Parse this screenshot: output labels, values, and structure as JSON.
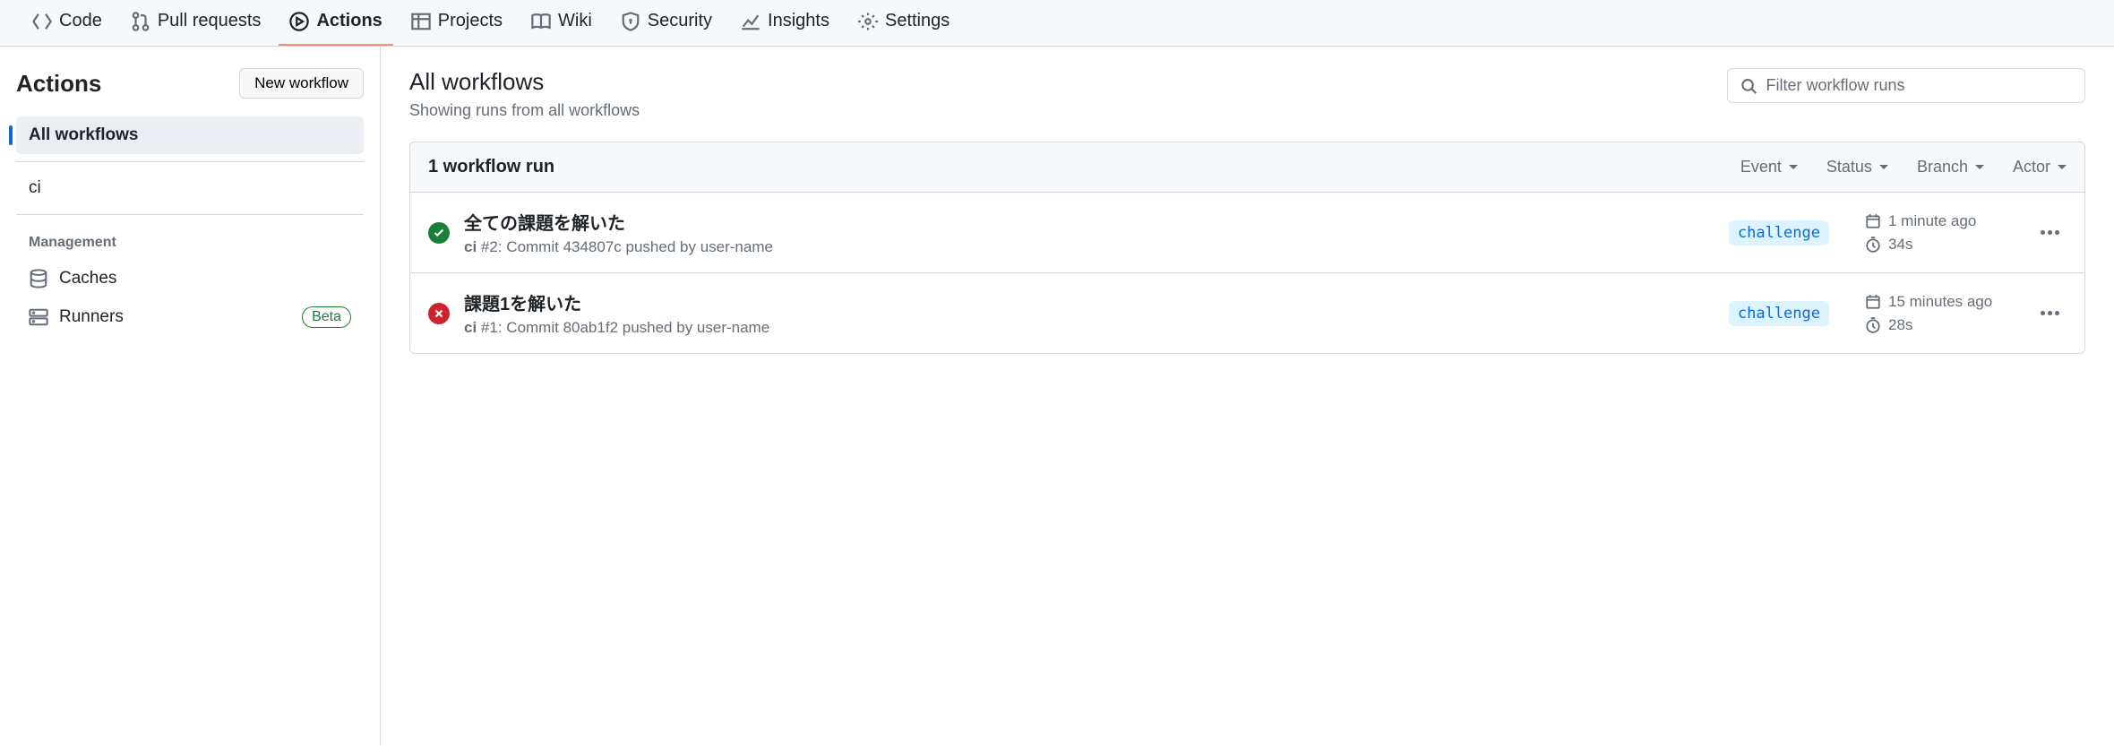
{
  "nav": {
    "tabs": [
      {
        "label": "Code"
      },
      {
        "label": "Pull requests"
      },
      {
        "label": "Actions"
      },
      {
        "label": "Projects"
      },
      {
        "label": "Wiki"
      },
      {
        "label": "Security"
      },
      {
        "label": "Insights"
      },
      {
        "label": "Settings"
      }
    ]
  },
  "sidebar": {
    "title": "Actions",
    "new_workflow_label": "New workflow",
    "all_workflows_label": "All workflows",
    "workflows": [
      {
        "name": "ci"
      }
    ],
    "management_header": "Management",
    "caches_label": "Caches",
    "runners_label": "Runners",
    "beta_label": "Beta"
  },
  "main": {
    "title": "All workflows",
    "subtitle": "Showing runs from all workflows",
    "search_placeholder": "Filter workflow runs",
    "runs_count_label": "1 workflow run",
    "filters": {
      "event": "Event",
      "status": "Status",
      "branch": "Branch",
      "actor": "Actor"
    },
    "runs": [
      {
        "status": "success",
        "title": "全ての課題を解いた",
        "workflow": "ci",
        "run_number": "#2",
        "subtitle_rest": ": Commit 434807c pushed by user-name",
        "branch": "challenge",
        "time": "1 minute ago",
        "duration": "34s"
      },
      {
        "status": "failure",
        "title": "課題1を解いた",
        "workflow": "ci",
        "run_number": "#1",
        "subtitle_rest": ": Commit 80ab1f2 pushed by user-name",
        "branch": "challenge",
        "time": "15 minutes ago",
        "duration": "28s"
      }
    ]
  }
}
